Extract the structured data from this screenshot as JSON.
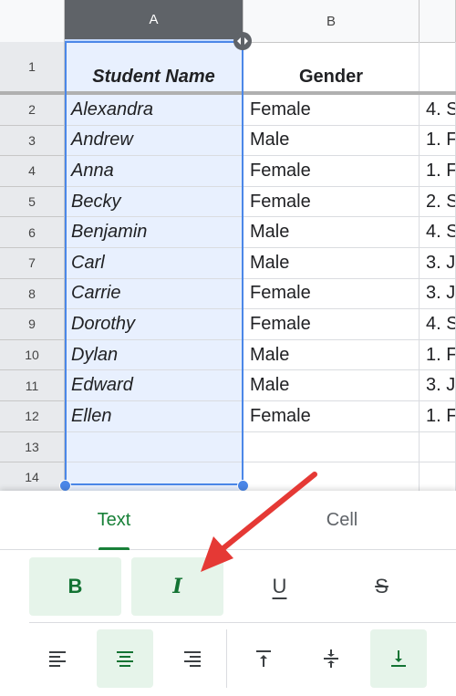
{
  "columns": [
    "A",
    "B"
  ],
  "header_row": {
    "num": "1",
    "a": "Student Name",
    "b": "Gender",
    "c": ""
  },
  "rows": [
    {
      "num": "2",
      "a": "Alexandra",
      "b": "Female",
      "c": "4. S"
    },
    {
      "num": "3",
      "a": "Andrew",
      "b": "Male",
      "c": "1. F"
    },
    {
      "num": "4",
      "a": "Anna",
      "b": "Female",
      "c": "1. F"
    },
    {
      "num": "5",
      "a": "Becky",
      "b": "Female",
      "c": "2. S"
    },
    {
      "num": "6",
      "a": "Benjamin",
      "b": "Male",
      "c": "4. S"
    },
    {
      "num": "7",
      "a": "Carl",
      "b": "Male",
      "c": "3. J"
    },
    {
      "num": "8",
      "a": "Carrie",
      "b": "Female",
      "c": "3. J"
    },
    {
      "num": "9",
      "a": "Dorothy",
      "b": "Female",
      "c": "4. S"
    },
    {
      "num": "10",
      "a": "Dylan",
      "b": "Male",
      "c": "1. F"
    },
    {
      "num": "11",
      "a": "Edward",
      "b": "Male",
      "c": "3. J"
    },
    {
      "num": "12",
      "a": "Ellen",
      "b": "Female",
      "c": "1. F"
    },
    {
      "num": "13",
      "a": "",
      "b": "",
      "c": ""
    },
    {
      "num": "14",
      "a": "",
      "b": "",
      "c": ""
    }
  ],
  "panel": {
    "tabs": {
      "text": "Text",
      "cell": "Cell"
    },
    "active_tab": "Text",
    "style_buttons": {
      "bold": "B",
      "italic": "I",
      "underline": "U",
      "strikethrough": "S"
    },
    "active_styles": [
      "bold",
      "italic"
    ],
    "align_icons": [
      "align-left-icon",
      "align-center-icon",
      "align-right-icon",
      "valign-top-icon",
      "valign-middle-icon",
      "valign-bottom-icon"
    ],
    "active_align": [
      "align-center",
      "valign-bottom"
    ]
  },
  "colors": {
    "accent_green": "#188038",
    "selection_blue": "#4b87e8",
    "annotation_red": "#e53935"
  }
}
